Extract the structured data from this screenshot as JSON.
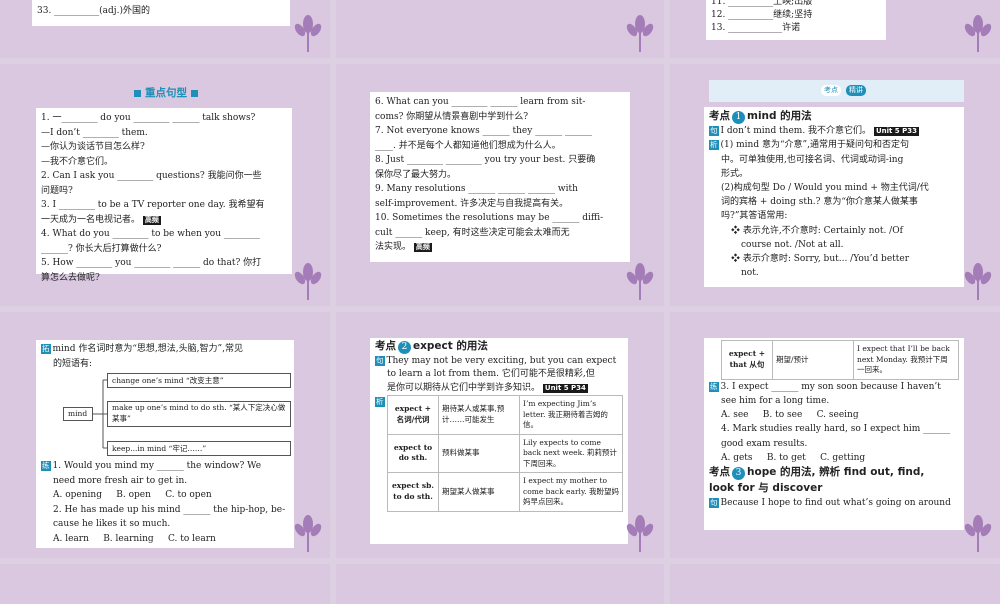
{
  "slide1": {
    "lines": [
      "33. __________(adj.)外国的"
    ]
  },
  "slide3": {
    "lines": [
      "11. __________上映;出版",
      "12. __________继续;坚持",
      "13. ____________许诺"
    ]
  },
  "slide4": {
    "header": "重点句型",
    "lines": [
      "1. 一________ do you ________ ______ talk shows?",
      "—I don’t ________ them.",
      "—你认为谈话节目怎么样?",
      "—我不介意它们。",
      "2. Can I ask you ________ questions? 我能问你一些",
      "问题吗?",
      "3. I ________ to be a TV reporter one day. 我希望有",
      "一天成为一名电视记者。",
      "4. What do you ________ to be when you ________",
      "______? 你长大后打算做什么?",
      "5. How ________ you ________ ______ do that? 你打",
      "算怎么去做呢?"
    ],
    "tag": "高频"
  },
  "slide5": {
    "lines": [
      "6. What can you ________ ______ learn from sit-",
      "coms? 你期望从情景喜剧中学到什么?",
      "7. Not everyone knows ______ they ______ ______",
      "____. 并不是每个人都知道他们想成为什么人。",
      "8. Just ________ ________ you try your best. 只要确",
      "保你尽了最大努力。",
      "9. Many resolutions ______ ______ ______ with",
      "self-improvement. 许多决定与自我提高有关。",
      "10. Sometimes the resolutions may be ______ diffi-",
      "cult ______ keep, 有时这些决定可能会太难而无",
      "法实现。"
    ],
    "tag": "高频"
  },
  "slide6": {
    "band_left": "考点",
    "band_right": "精讲",
    "title_prefix": "考点",
    "num": "1",
    "title": "mind 的用法",
    "ju_mark": "句",
    "ju_text": "I don’t mind them. 我不介意它们。",
    "unit": "Unit 5 P33",
    "xi_mark": "析",
    "lines": [
      "(1) mind 意为“介意”,通常用于疑问句和否定句",
      "中。可单独使用,也可接名词、代词或动词-ing",
      "形式。",
      "(2)构成句型 Do / Would you mind + 物主代词/代",
      "词的宾格 + doing sth.? 意为“你介意某人做某事",
      "吗?”其答语常用:",
      "❖ 表示允许,不介意时: Certainly not. /Of",
      "course not. /Not at all.",
      "❖ 表示介意时: Sorry, but... /You’d better",
      "not."
    ]
  },
  "slide7": {
    "tuo_mark": "拓",
    "intro1": "mind 作名词时意为“思想,想法,头脑,智力”,常见",
    "intro2": "的短语有:",
    "mind_word": "mind",
    "phrases": [
      "change one’s mind “改变主意”",
      "make up one’s mind to do sth. “某人下定决心做某事”",
      "keep...in mind “牢记……”"
    ],
    "lian_mark": "练",
    "lines": [
      "1. Would you mind my ______ the window? We",
      "need more fresh air to get in.",
      "A. opening     B. open     C. to open",
      "2. He has made up his mind ______ the hip-hop, be-",
      "cause he likes it so much.",
      "A. learn     B. learning     C. to learn"
    ]
  },
  "slide8": {
    "title_prefix": "考点",
    "num": "2",
    "title": "expect 的用法",
    "ju_mark": "句",
    "ju_lines": [
      "They may not be very exciting, but you can expect",
      "to learn a lot from them. 它们可能不是很精彩,但",
      "是你可以期待从它们中学到许多知识。"
    ],
    "unit": "Unit 5 P34",
    "xi_mark": "析",
    "table": [
      [
        "expect + 名词/代词",
        "期待某人或某事,预计……可能发生",
        "I’m expecting Jim’s letter. 我正期待着吉姆的信。"
      ],
      [
        "expect to do sth.",
        "预料做某事",
        "Lily expects to come back next week. 莉莉预计下周回来。"
      ],
      [
        "expect sb. to do sth.",
        "期望某人做某事",
        "I expect my mother to come back early. 我盼望妈妈早点回来。"
      ]
    ]
  },
  "slide9": {
    "row": [
      "expect + that 从句",
      "期望/预计",
      "I expect that I’ll be back next Monday. 我预计下周一回来。"
    ],
    "lian_mark": "练",
    "lines": [
      "3. I expect ______ my son soon because I haven’t",
      "see him for a long time.",
      "A. see     B. to see     C. seeing",
      "4. Mark studies really hard, so I expect him ______",
      "good exam results.",
      "A. gets     B. to get     C. getting"
    ],
    "title_prefix": "考点",
    "num": "3",
    "title1": "hope 的用法, 辨析 find out, find,",
    "title2": "look for 与 discover",
    "ju_mark": "句",
    "ju_text": "Because I hope to find out what’s going on around"
  }
}
